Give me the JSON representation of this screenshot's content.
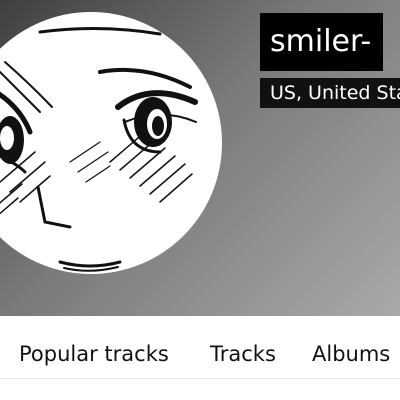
{
  "profile": {
    "username": "smiler-",
    "location": "US, United States"
  },
  "tabs": [
    {
      "label": "Popular tracks"
    },
    {
      "label": "Tracks"
    },
    {
      "label": "Albums"
    }
  ]
}
